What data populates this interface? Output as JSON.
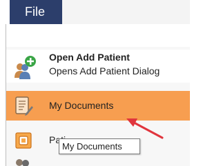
{
  "header": {
    "file_tab_label": "File"
  },
  "menu": {
    "items": [
      {
        "title": "Open Add Patient",
        "description": "Opens Add Patient Dialog",
        "icon": "add-patient-icon"
      },
      {
        "title": "My Documents",
        "icon": "documents-icon",
        "highlighted": true
      },
      {
        "title": "Pati",
        "icon": "print-icon"
      },
      {
        "icon": "people-icon"
      }
    ]
  },
  "tooltip": {
    "text": "My Documents"
  },
  "colors": {
    "file_tab": "#2c3e6b",
    "highlight": "#f79e50",
    "annotation_arrow": "#e0353d"
  }
}
